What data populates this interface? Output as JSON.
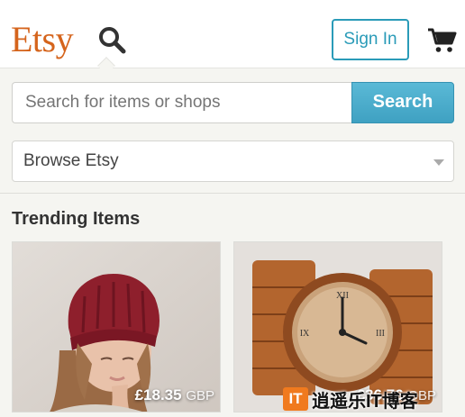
{
  "header": {
    "logo": "Etsy",
    "search_icon": "search-icon",
    "signin_label": "Sign In",
    "cart_icon": "cart-icon"
  },
  "search": {
    "placeholder": "Search for items or shops",
    "button_label": "Search"
  },
  "browse": {
    "label": "Browse Etsy",
    "arrow_icon": "caret-down-icon"
  },
  "trending": {
    "title": "Trending Items",
    "items": [
      {
        "image": "woman-in-red-knit-beanie",
        "price": "£18.35",
        "currency": "GBP"
      },
      {
        "image": "wooden-wristwatch",
        "price": "£36.76",
        "currency": "GBP"
      }
    ]
  },
  "watermark": {
    "logo": "IT",
    "text": "逍遥乐IT博客"
  },
  "colors": {
    "brand": "#d5641c",
    "accent": "#2a9bb8",
    "search_button": "#4aaccb"
  }
}
